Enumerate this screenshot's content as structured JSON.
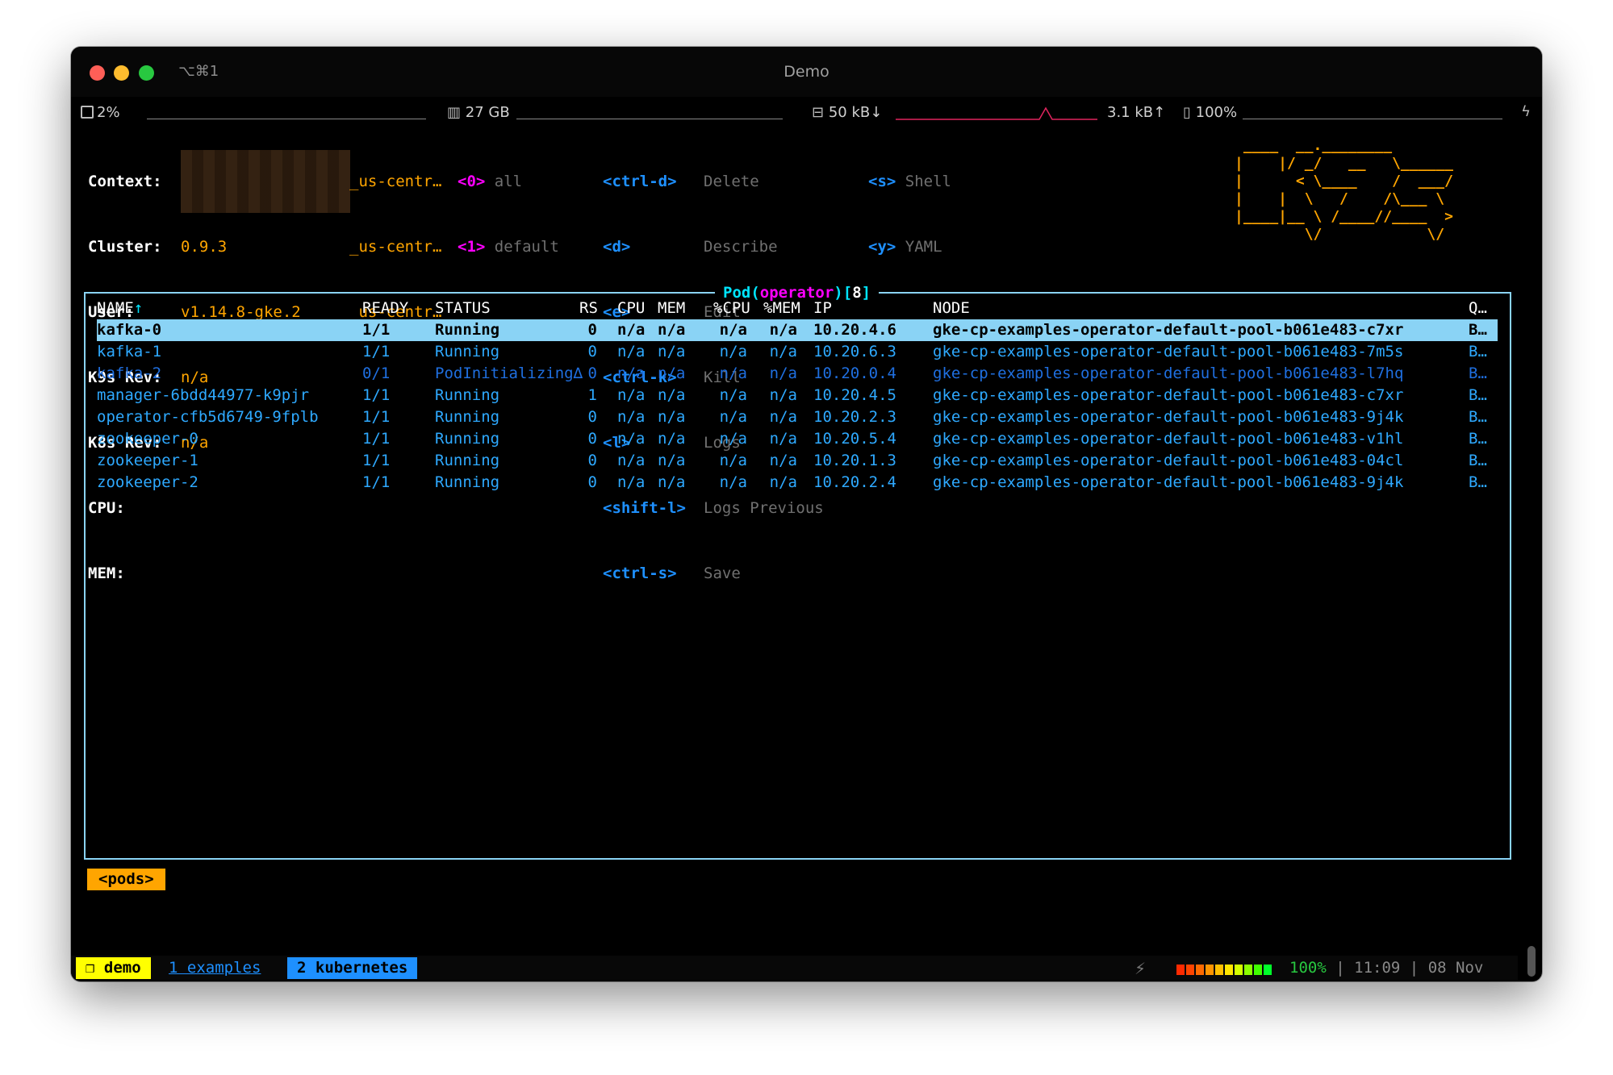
{
  "window": {
    "title": "Demo",
    "shortcut": "⌥⌘1"
  },
  "statusbar": {
    "cpu": "2%",
    "memory": "27 GB",
    "net_down": "50 kB↓",
    "net_up": "3.1 kB↑",
    "battery": "100%"
  },
  "info": {
    "context_label": "Context:",
    "context_value": "_us-centr…",
    "cluster_label": "Cluster:",
    "cluster_value": "_us-centr…",
    "user_label": "User:",
    "user_value": "_us-centr…",
    "k9s_label": "K9s Rev:",
    "k9s_value": "0.9.3",
    "k8s_label": "K8s Rev:",
    "k8s_value": "v1.14.8-gke.2",
    "cpu_label": "CPU:",
    "cpu_value": "n/a",
    "mem_label": "MEM:",
    "mem_value": "n/a"
  },
  "namespaces": [
    {
      "key": "<0>",
      "label": "all"
    },
    {
      "key": "<1>",
      "label": "default"
    }
  ],
  "hotkeys_col1": [
    {
      "key": "<ctrl-d>",
      "label": "Delete"
    },
    {
      "key": "<d>",
      "label": "Describe"
    },
    {
      "key": "<e>",
      "label": "Edit"
    },
    {
      "key": "<ctrl-k>",
      "label": "Kill"
    },
    {
      "key": "<l>",
      "label": "Logs"
    },
    {
      "key": "<shift-l>",
      "label": "Logs Previous"
    },
    {
      "key": "<ctrl-s>",
      "label": "Save"
    }
  ],
  "hotkeys_col2": [
    {
      "key": "<s>",
      "label": "Shell"
    },
    {
      "key": "<y>",
      "label": "YAML"
    }
  ],
  "logo_art": " ____  __.________\n|    |/ _/   __   \\______\n|      < \\____    /  ___/\n|    |  \\   /    /\\___ \\\n|____|__ \\ /____//____  >\n        \\/            \\/",
  "table": {
    "kind": "Pod",
    "namespace": "operator",
    "count": "8",
    "title_open": "(",
    "title_close": ")",
    "count_open": "[",
    "count_close": "]",
    "sort_arrow": "↑",
    "columns": {
      "name": "NAME",
      "ready": "READY",
      "status": "STATUS",
      "rs": "RS",
      "cpu": "CPU",
      "mem": "MEM",
      "pcpu": "%CPU",
      "pmem": "%MEM",
      "ip": "IP",
      "node": "NODE",
      "q": "Q…"
    },
    "rows": [
      {
        "name": "kafka-0",
        "ready": "1/1",
        "status": "Running",
        "rs": "0",
        "cpu": "n/a",
        "mem": "n/a",
        "pcpu": "n/a",
        "pmem": "n/a",
        "ip": "10.20.4.6",
        "node": "gke-cp-examples-operator-default-pool-b061e483-c7xr",
        "q": "B…"
      },
      {
        "name": "kafka-1",
        "ready": "1/1",
        "status": "Running",
        "rs": "0",
        "cpu": "n/a",
        "mem": "n/a",
        "pcpu": "n/a",
        "pmem": "n/a",
        "ip": "10.20.6.3",
        "node": "gke-cp-examples-operator-default-pool-b061e483-7m5s",
        "q": "B…"
      },
      {
        "name": "kafka-2",
        "ready": "0/1",
        "status": "PodInitializing∆",
        "rs": "0",
        "cpu": "n/a",
        "mem": "n/a",
        "pcpu": "n/a",
        "pmem": "n/a",
        "ip": "10.20.0.4",
        "node": "gke-cp-examples-operator-default-pool-b061e483-l7hq",
        "q": "B…"
      },
      {
        "name": "manager-6bdd44977-k9pjr",
        "ready": "1/1",
        "status": "Running",
        "rs": "1",
        "cpu": "n/a",
        "mem": "n/a",
        "pcpu": "n/a",
        "pmem": "n/a",
        "ip": "10.20.4.5",
        "node": "gke-cp-examples-operator-default-pool-b061e483-c7xr",
        "q": "B…"
      },
      {
        "name": "operator-cfb5d6749-9fplb",
        "ready": "1/1",
        "status": "Running",
        "rs": "0",
        "cpu": "n/a",
        "mem": "n/a",
        "pcpu": "n/a",
        "pmem": "n/a",
        "ip": "10.20.2.3",
        "node": "gke-cp-examples-operator-default-pool-b061e483-9j4k",
        "q": "B…"
      },
      {
        "name": "zookeeper-0",
        "ready": "1/1",
        "status": "Running",
        "rs": "0",
        "cpu": "n/a",
        "mem": "n/a",
        "pcpu": "n/a",
        "pmem": "n/a",
        "ip": "10.20.5.4",
        "node": "gke-cp-examples-operator-default-pool-b061e483-v1hl",
        "q": "B…"
      },
      {
        "name": "zookeeper-1",
        "ready": "1/1",
        "status": "Running",
        "rs": "0",
        "cpu": "n/a",
        "mem": "n/a",
        "pcpu": "n/a",
        "pmem": "n/a",
        "ip": "10.20.1.3",
        "node": "gke-cp-examples-operator-default-pool-b061e483-04cl",
        "q": "B…"
      },
      {
        "name": "zookeeper-2",
        "ready": "1/1",
        "status": "Running",
        "rs": "0",
        "cpu": "n/a",
        "mem": "n/a",
        "pcpu": "n/a",
        "pmem": "n/a",
        "ip": "10.20.2.4",
        "node": "gke-cp-examples-operator-default-pool-b061e483-9j4k",
        "q": "B…"
      }
    ]
  },
  "crumb": "<pods>",
  "tmux": {
    "tab_demo": "❐ demo",
    "tab_examples": "1 examples",
    "tab_kubernetes": "2 kubernetes",
    "battery_pct": "100%",
    "time": "11:09",
    "date": "08 Nov",
    "sep": "|"
  },
  "colors": {
    "accent_cyan": "#8ad3f5",
    "hotkey_blue": "#1e90ff",
    "namespace_magenta": "#ff00ff",
    "value_orange": "#ffa500",
    "row_blue": "#2ea9ff"
  }
}
